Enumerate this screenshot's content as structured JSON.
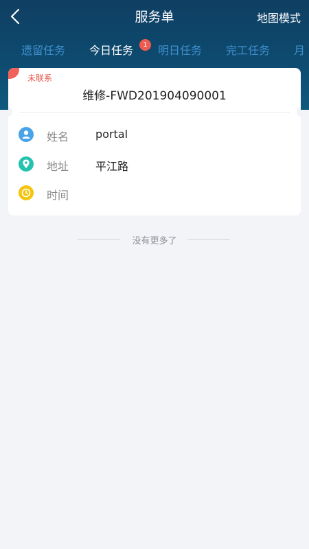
{
  "nav": {
    "title": "服务单",
    "map_mode": "地图模式"
  },
  "tabs": [
    {
      "label": "遗留任务",
      "active": false
    },
    {
      "label": "今日任务",
      "active": true,
      "badge": "1"
    },
    {
      "label": "明日任务",
      "active": false
    },
    {
      "label": "完工任务",
      "active": false
    },
    {
      "label": "月",
      "active": false
    }
  ],
  "order": {
    "status": "未联系",
    "number": "维修-FWD201904090001",
    "rows": [
      {
        "label": "姓名",
        "value": "portal",
        "icon": "person-icon",
        "color": "#4aa3e8"
      },
      {
        "label": "地址",
        "value": "平江路",
        "icon": "location-icon",
        "color": "#25c2b0"
      },
      {
        "label": "时间",
        "value": "",
        "icon": "clock-icon",
        "color": "#f4c40f"
      }
    ]
  },
  "footer": {
    "no_more": "没有更多了"
  },
  "colors": {
    "header_bg": "#0e4a6f",
    "tab_active": "#ffffff",
    "tab_inactive": "#3e8fcc",
    "badge": "#f05b4f",
    "status_red": "#e4574d"
  }
}
